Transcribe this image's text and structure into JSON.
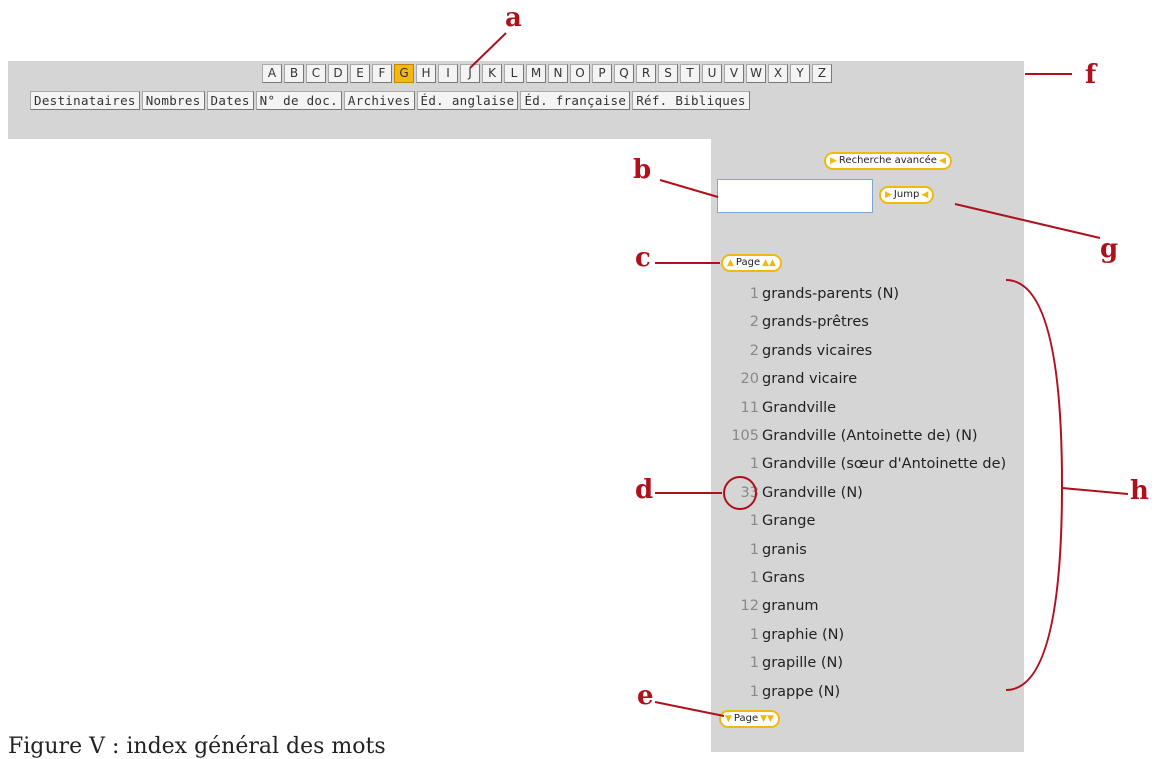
{
  "header": {
    "letters": [
      "A",
      "B",
      "C",
      "D",
      "E",
      "F",
      "G",
      "H",
      "I",
      "J",
      "K",
      "L",
      "M",
      "N",
      "O",
      "P",
      "Q",
      "R",
      "S",
      "T",
      "U",
      "V",
      "W",
      "X",
      "Y",
      "Z"
    ],
    "active_letter": "G",
    "tabs": [
      "Destinataires",
      "Nombres",
      "Dates",
      "N° de doc.",
      "Archives",
      "Éd. anglaise",
      "Éd. française",
      "Réf. Bibliques"
    ]
  },
  "sidebar": {
    "advanced_search_label": "Recherche avancée",
    "jump_label": "Jump",
    "page_up_label": "Page",
    "page_down_label": "Page",
    "search_value": "",
    "entries": [
      {
        "count": "1",
        "word": "grands-parents (N)"
      },
      {
        "count": "2",
        "word": "grands-prêtres"
      },
      {
        "count": "2",
        "word": "grands vicaires"
      },
      {
        "count": "20",
        "word": "grand vicaire"
      },
      {
        "count": "11",
        "word": "Grandville"
      },
      {
        "count": "105",
        "word": "Grandville (Antoinette de) (N)"
      },
      {
        "count": "1",
        "word": "Grandville (sœur d'Antoinette de)"
      },
      {
        "count": "33",
        "word": "Grandville (N)"
      },
      {
        "count": "1",
        "word": "Grange"
      },
      {
        "count": "1",
        "word": "granis"
      },
      {
        "count": "1",
        "word": "Grans"
      },
      {
        "count": "12",
        "word": "granum"
      },
      {
        "count": "1",
        "word": "graphie (N)"
      },
      {
        "count": "1",
        "word": "grapille (N)"
      },
      {
        "count": "1",
        "word": "grappe (N)"
      }
    ]
  },
  "annotations": {
    "a": "a",
    "b": "b",
    "c": "c",
    "d": "d",
    "e": "e",
    "f": "f",
    "g": "g",
    "h": "h"
  },
  "caption": "Figure V : index général des mots",
  "colors": {
    "accent": "#f2b90d",
    "annotation": "#b0101c",
    "panel": "#d5d5d5"
  }
}
